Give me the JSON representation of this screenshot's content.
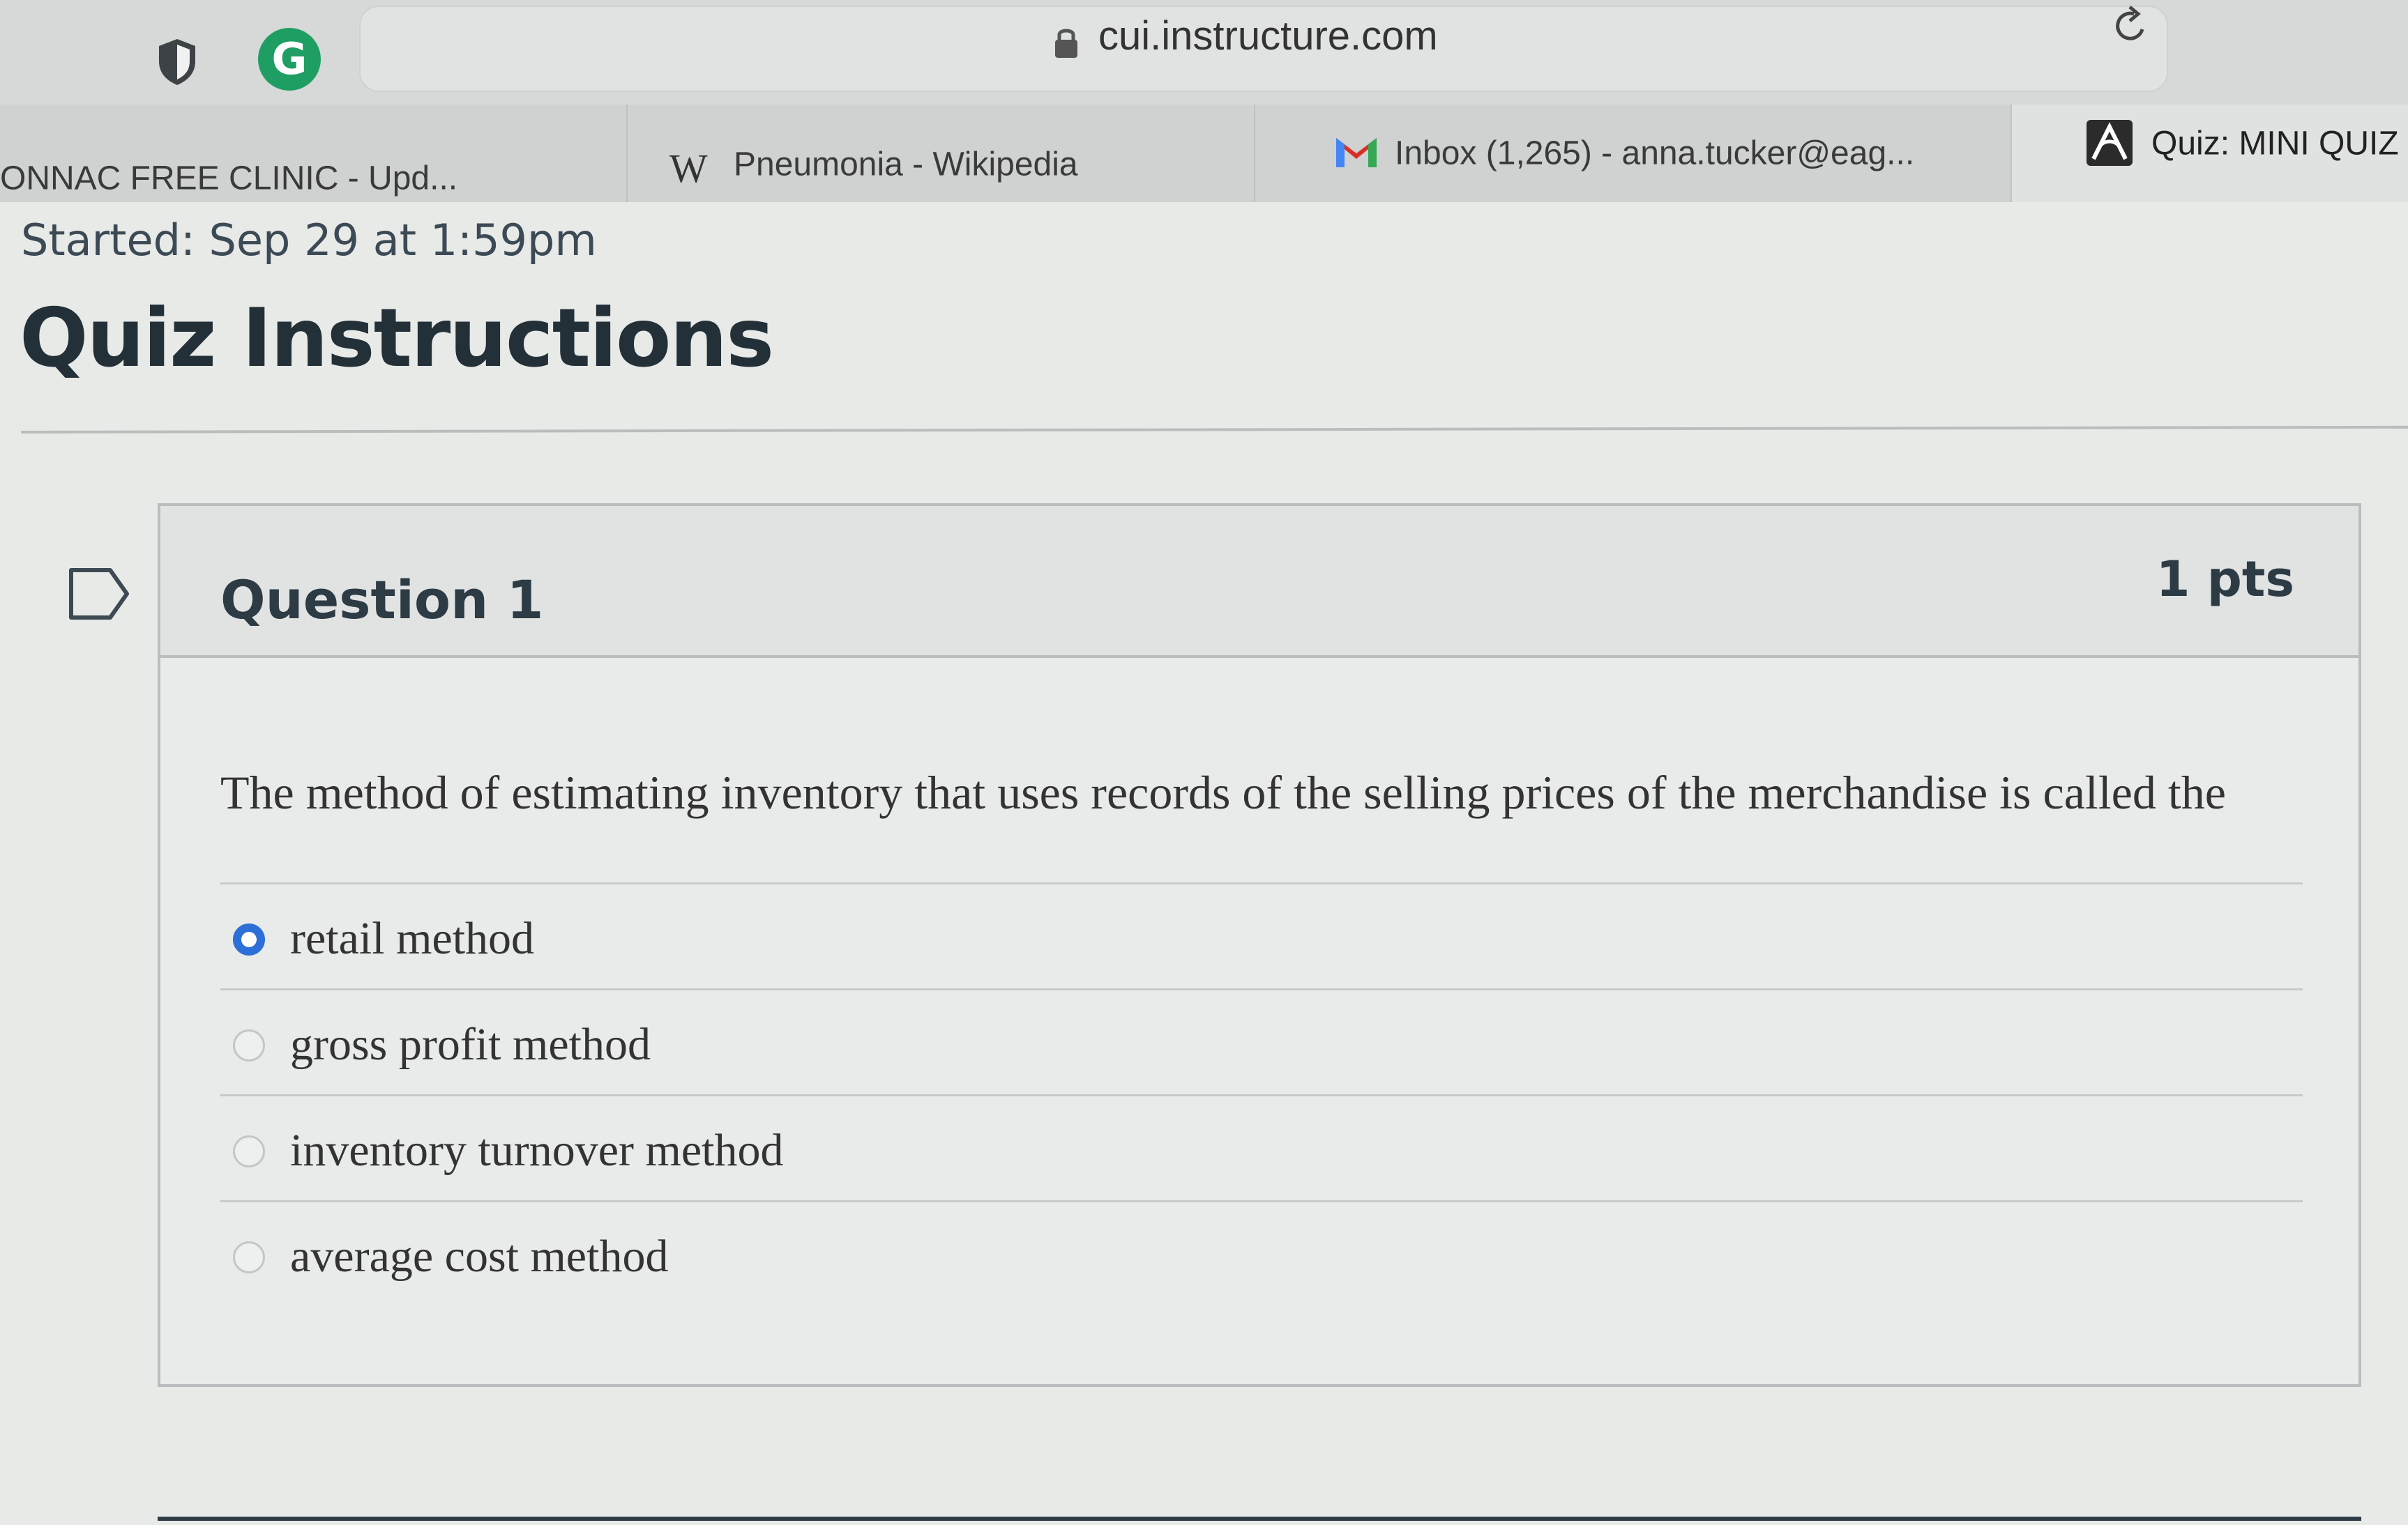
{
  "browser": {
    "url": "cui.instructure.com",
    "tabs": [
      {
        "label": "ONNAC FREE CLINIC - Upd...",
        "icon": "none"
      },
      {
        "label": "Pneumonia - Wikipedia",
        "icon": "wikipedia-icon",
        "icon_glyph": "W"
      },
      {
        "label": "Inbox (1,265) - anna.tucker@eag...",
        "icon": "gmail-icon"
      },
      {
        "label": "Quiz: MINI QUIZ",
        "icon": "canvas-quiz-icon"
      }
    ]
  },
  "page": {
    "started": "Started: Sep 29 at 1:59pm",
    "title": "Quiz Instructions"
  },
  "question": {
    "title": "Question 1",
    "points": "1 pts",
    "text": "The method of estimating inventory that uses records of the selling prices of the merchandise is called the",
    "answers": [
      {
        "label": "retail method",
        "selected": true
      },
      {
        "label": "gross profit method",
        "selected": false
      },
      {
        "label": "inventory turnover method",
        "selected": false
      },
      {
        "label": "average cost method",
        "selected": false
      }
    ]
  },
  "colors": {
    "radio_selected": "#2c6fd6",
    "grammarly": "#1f9e63",
    "text_dark": "#2d3b45"
  }
}
